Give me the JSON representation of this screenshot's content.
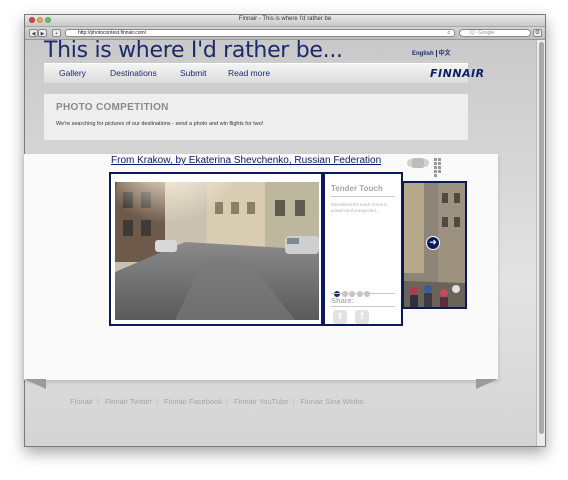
{
  "browser": {
    "title": "Finnair - This is where I'd rather be",
    "url": "http://photocontest.finnair.com/",
    "search_placeholder": "Q~ Google",
    "reload_icon": "reload-icon"
  },
  "header": {
    "headline": "This is where I'd rather be...",
    "lang_english": "English",
    "lang_chinese": "中文"
  },
  "nav": {
    "items": [
      "Gallery",
      "Destinations",
      "Submit",
      "Read more"
    ],
    "logo": "FINNAIR"
  },
  "competition": {
    "title": "PHOTO COMPETITION",
    "text": "We're searching for pictures of our destinations - send a photo and win flights for two!"
  },
  "gallery": {
    "photo_title": "From Krakow, by Ekaterina Shevchenko, Russian Federation",
    "info_title": "Tender Touch",
    "info_desc": "Sometimes the touch of sun is unseen and unexpected...",
    "share_label": "Share:",
    "dots_total": 5,
    "active_dot": 0,
    "twitter_icon": "twitter-icon",
    "facebook_icon": "facebook-icon"
  },
  "footer": {
    "links": [
      "Finnair",
      "Finnair Twitter",
      "Finnair Facebook",
      "Finnair YouTube",
      "Finnair Sina Weibo"
    ]
  },
  "colors": {
    "brand_navy": "#1b2a6b",
    "frame_navy": "#0b1a5c"
  }
}
